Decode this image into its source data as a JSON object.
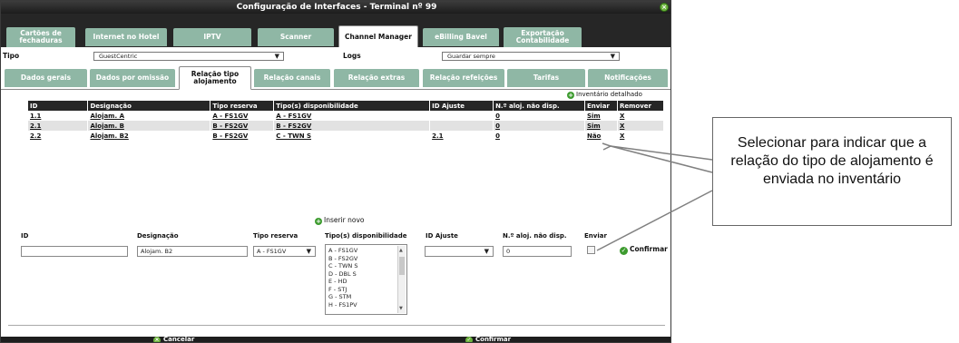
{
  "window": {
    "title": "Configuração de Interfaces - Terminal nº 99",
    "close_icon": "close-icon"
  },
  "top_tabs": [
    {
      "label": "Cartões de fechaduras"
    },
    {
      "label": "Internet no Hotel"
    },
    {
      "label": "IPTV"
    },
    {
      "label": "Scanner"
    },
    {
      "label": "Channel Manager",
      "active": true
    },
    {
      "label": "eBilling Bavel"
    },
    {
      "label": "Exportação Contabilidade"
    }
  ],
  "tipo": {
    "label": "Tipo",
    "value": "GuestCentric",
    "logs_label": "Logs",
    "logs_value": "Guardar sempre"
  },
  "sub_tabs": [
    {
      "label": "Dados gerais"
    },
    {
      "label": "Dados por omissão"
    },
    {
      "label": "Relação tipo alojamento",
      "active": true
    },
    {
      "label": "Relação canais"
    },
    {
      "label": "Relação extras"
    },
    {
      "label": "Relação refeições"
    },
    {
      "label": "Tarifas"
    },
    {
      "label": "Notificações"
    }
  ],
  "inventory_link": "Inventário detalhado",
  "table": {
    "headers": [
      "ID",
      "Designação",
      "Tipo reserva",
      "Tipo(s) disponibilidade",
      "ID Ajuste",
      "N.º aloj. não disp.",
      "Enviar",
      "Remover"
    ],
    "rows": [
      [
        "1.1",
        "Alojam. A",
        "A - FS1GV",
        "A - FS1GV",
        "",
        "0",
        "Sim",
        "X"
      ],
      [
        "2.1",
        "Alojam. B",
        "B - FS2GV",
        "B - FS2GV",
        "",
        "0",
        "Sim",
        "X"
      ],
      [
        "2.2",
        "Alojam. B2",
        "B - FS2GV",
        "C - TWN S",
        "2.1",
        "0",
        "Não",
        "X"
      ]
    ]
  },
  "insert": {
    "label": "Inserir novo",
    "fields": {
      "id_label": "ID",
      "designacao_label": "Designação",
      "designacao_value": "Alojam. B2",
      "tipo_reserva_label": "Tipo reserva",
      "tipo_reserva_value": "A - FS1GV",
      "tipo_disp_label": "Tipo(s) disponibilidade",
      "tipo_disp_options": [
        "A - FS1GV",
        "B - FS2GV",
        "C - TWN S",
        "D - DBL S",
        "E - HD",
        "F - STJ",
        "G - STM",
        "H - FS1PV"
      ],
      "id_ajuste_label": "ID Ajuste",
      "naloj_label": "N.º aloj. não disp.",
      "naloj_value": "0",
      "enviar_label": "Enviar",
      "confirm_label": "Confirmar"
    }
  },
  "footer": {
    "cancel": "Cancelar",
    "confirm": "Confirmar"
  },
  "callout": {
    "text": "Selecionar para indicar que a relação do tipo de alojamento é enviada no inventário"
  },
  "colors": {
    "tab_bg": "#8fb7a5",
    "header_dark": "#262626",
    "accent_green": "#3d9b2f"
  }
}
